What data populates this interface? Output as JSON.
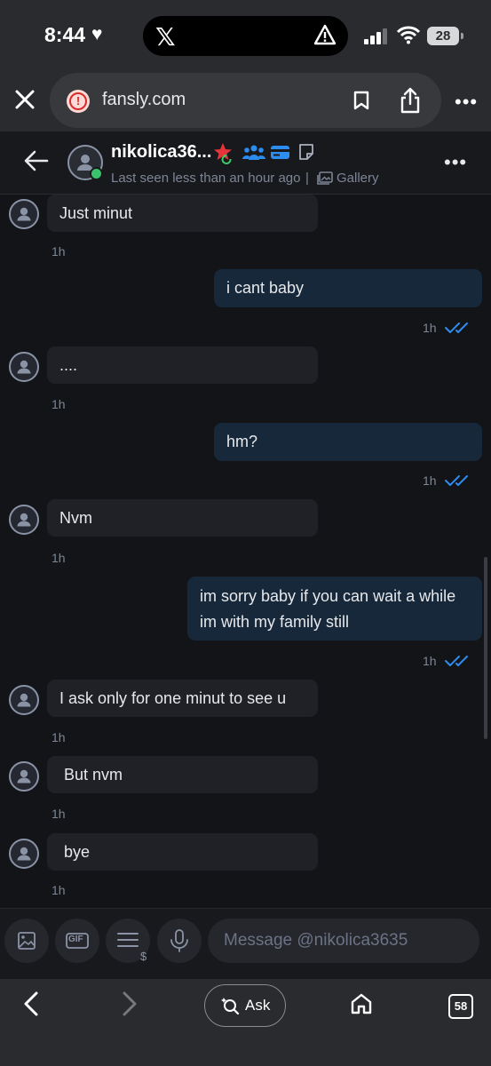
{
  "status_bar": {
    "time": "8:44",
    "battery": "28"
  },
  "browser": {
    "url": "fansly.com",
    "tab_count": "58",
    "ask_label": "Ask"
  },
  "chat": {
    "username": "nikolica36...",
    "last_seen": "Last seen less than an hour ago",
    "separator": "|",
    "gallery_label": "Gallery"
  },
  "messages": [
    {
      "from": "them",
      "text": "Just minut",
      "time": "1h"
    },
    {
      "from": "me",
      "text": "i cant baby",
      "time": "1h",
      "read": true
    },
    {
      "from": "them",
      "text": "....",
      "time": "1h"
    },
    {
      "from": "me",
      "text": "hm?",
      "time": "1h",
      "read": true
    },
    {
      "from": "them",
      "text": "Nvm",
      "time": "1h"
    },
    {
      "from": "me",
      "text_line1": "im sorry baby if you can wait a while",
      "text_line2": "im with my family still",
      "time": "1h",
      "read": true
    },
    {
      "from": "them",
      "text": "I ask only for one minut to see u",
      "time": "1h"
    },
    {
      "from": "them",
      "text": " But nvm",
      "time": "1h"
    },
    {
      "from": "them",
      "text": " bye",
      "time": "1h"
    }
  ],
  "compose": {
    "placeholder": "Message @nikolica3635",
    "gif_label": "GIF",
    "tip_symbol": "$"
  },
  "colors": {
    "accent": "#2d8cf0",
    "outgoing_bubble": "#16283a",
    "incoming_bubble": "#1f2126",
    "online": "#39c46b"
  }
}
